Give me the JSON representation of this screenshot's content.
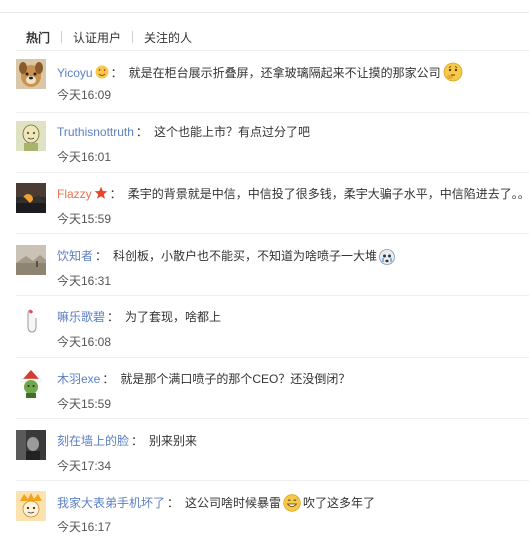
{
  "tabs": [
    {
      "label": "热门"
    },
    {
      "label": "认证用户"
    },
    {
      "label": "关注的人"
    }
  ],
  "comments": [
    {
      "user": "Yicoyu",
      "text": "就是在柜台展示折叠屏，还拿玻璃隔起来不让摸的那家公司",
      "time": "今天16:09",
      "avatar_icon": "dog-avatar-icon",
      "badge_icon": "heart-eyes-emoji-icon",
      "emoji_icon": "thinking-emoji-icon"
    },
    {
      "user": "Truthisnottruth",
      "text": "这个也能上市？有点过分了吧",
      "time": "今天16:01",
      "avatar_icon": "sketch-avatar-icon"
    },
    {
      "user": "Flazzy",
      "text": "柔宇的背景就是中信，中信投了很多钱，柔宇大骗子水平，中信陷进去了。。",
      "time": "今天15:59",
      "avatar_icon": "sunset-avatar-icon",
      "badge_icon": "star-badge-icon"
    },
    {
      "user": "饮知者",
      "text": "科创板，小散户也不能买，不知道为啥喷子一大堆",
      "time": "今天16:31",
      "avatar_icon": "landscape-avatar-icon",
      "emoji_icon": "crying-emoji-icon"
    },
    {
      "user": "嘛乐歌碧",
      "text": "为了套现，啥都上",
      "time": "今天16:08",
      "avatar_icon": "finger-heart-avatar-icon"
    },
    {
      "user": "木羽exe",
      "text": "就是那个满口喷子的那个CEO？还没倒闭？",
      "time": "今天15:59",
      "avatar_icon": "santa-hat-avatar-icon"
    },
    {
      "user": "刻在墙上的脸",
      "text": "别来别来",
      "time": "今天17:34",
      "avatar_icon": "dark-portrait-avatar-icon"
    },
    {
      "user": "我家大表弟手机坏了",
      "text": "这公司啥时候暴雷",
      "text_after": "吹了这多年了",
      "time": "今天16:17",
      "avatar_icon": "cartoon-avatar-icon",
      "inline_emoji_icon": "grinning-sweat-emoji-icon"
    }
  ],
  "colors": {
    "username_orange": "#eb7350",
    "username_blue": "#5b7fc4",
    "time_gray": "#555555"
  }
}
